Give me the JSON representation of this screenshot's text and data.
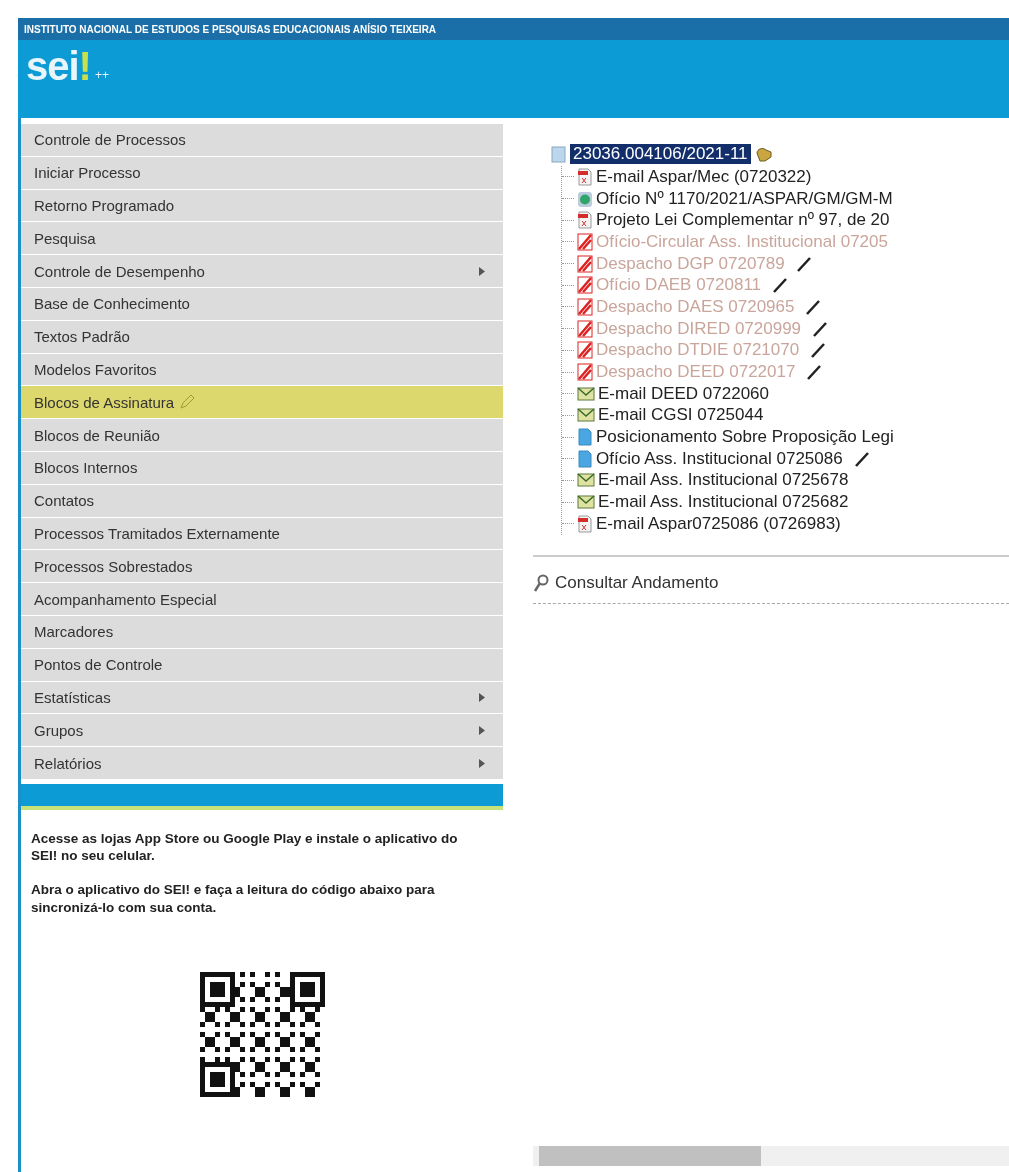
{
  "header": {
    "institution": "INSTITUTO NACIONAL DE ESTUDOS E PESQUISAS EDUCACIONAIS ANÍSIO TEIXEIRA",
    "logo": "sei",
    "logo_mark": "!",
    "logo_suffix": "++"
  },
  "menu": [
    {
      "label": "Controle de Processos",
      "selected": false,
      "submenu": false
    },
    {
      "label": "Iniciar Processo",
      "selected": false,
      "submenu": false
    },
    {
      "label": "Retorno Programado",
      "selected": false,
      "submenu": false
    },
    {
      "label": "Pesquisa",
      "selected": false,
      "submenu": false
    },
    {
      "label": "Controle de Desempenho",
      "selected": false,
      "submenu": true
    },
    {
      "label": "Base de Conhecimento",
      "selected": false,
      "submenu": false
    },
    {
      "label": "Textos Padrão",
      "selected": false,
      "submenu": false
    },
    {
      "label": "Modelos Favoritos",
      "selected": false,
      "submenu": false
    },
    {
      "label": "Blocos de Assinatura",
      "selected": true,
      "submenu": false
    },
    {
      "label": "Blocos de Reunião",
      "selected": false,
      "submenu": false
    },
    {
      "label": "Blocos Internos",
      "selected": false,
      "submenu": false
    },
    {
      "label": "Contatos",
      "selected": false,
      "submenu": false
    },
    {
      "label": "Processos Tramitados Externamente",
      "selected": false,
      "submenu": false
    },
    {
      "label": "Processos Sobrestados",
      "selected": false,
      "submenu": false
    },
    {
      "label": "Acompanhamento Especial",
      "selected": false,
      "submenu": false
    },
    {
      "label": "Marcadores",
      "selected": false,
      "submenu": false
    },
    {
      "label": "Pontos de Controle",
      "selected": false,
      "submenu": false
    },
    {
      "label": "Estatísticas",
      "selected": false,
      "submenu": true
    },
    {
      "label": "Grupos",
      "selected": false,
      "submenu": true
    },
    {
      "label": "Relatórios",
      "selected": false,
      "submenu": true
    }
  ],
  "app_notice": [
    "Acesse as lojas App Store ou Google Play e instale o aplicativo do SEI! no seu celular.",
    "Abra o aplicativo do SEI! e faça a leitura do código abaixo para sincronizá-lo com sua conta."
  ],
  "process": {
    "number": "23036.004106/2021-11",
    "selected": true,
    "documents": [
      {
        "kind": "pdf",
        "label": "E-mail Aspar/Mec (0720322)",
        "pen": false
      },
      {
        "kind": "web",
        "label": "Ofício Nº 1170/2021/ASPAR/GM/GM-M",
        "pen": false
      },
      {
        "kind": "pdf",
        "label": "Projeto Lei Complementar nº 97, de 20",
        "pen": false
      },
      {
        "kind": "cancelled",
        "label": "Ofício-Circular Ass. Institucional 07205",
        "pen": false
      },
      {
        "kind": "cancelled",
        "label": "Despacho DGP 0720789",
        "pen": true
      },
      {
        "kind": "cancelled",
        "label": "Ofício DAEB 0720811",
        "pen": true
      },
      {
        "kind": "cancelled",
        "label": "Despacho DAES 0720965",
        "pen": true
      },
      {
        "kind": "cancelled",
        "label": "Despacho DIRED 0720999",
        "pen": true
      },
      {
        "kind": "cancelled",
        "label": "Despacho DTDIE 0721070",
        "pen": true
      },
      {
        "kind": "cancelled",
        "label": "Despacho DEED 0722017",
        "pen": true
      },
      {
        "kind": "email",
        "label": "E-mail DEED 0722060",
        "pen": false
      },
      {
        "kind": "email",
        "label": "E-mail CGSI 0725044",
        "pen": false
      },
      {
        "kind": "doc",
        "label": "Posicionamento Sobre Proposição Legi",
        "pen": false
      },
      {
        "kind": "doc",
        "label": "Ofício Ass. Institucional 0725086",
        "pen": true
      },
      {
        "kind": "email",
        "label": "E-mail Ass. Institucional 0725678",
        "pen": false
      },
      {
        "kind": "email",
        "label": "E-mail Ass. Institucional 0725682",
        "pen": false
      },
      {
        "kind": "pdf",
        "label": "E-mail Aspar0725086 (0726983)",
        "pen": false
      }
    ]
  },
  "actions": [
    {
      "label": "Consultar Andamento"
    }
  ]
}
